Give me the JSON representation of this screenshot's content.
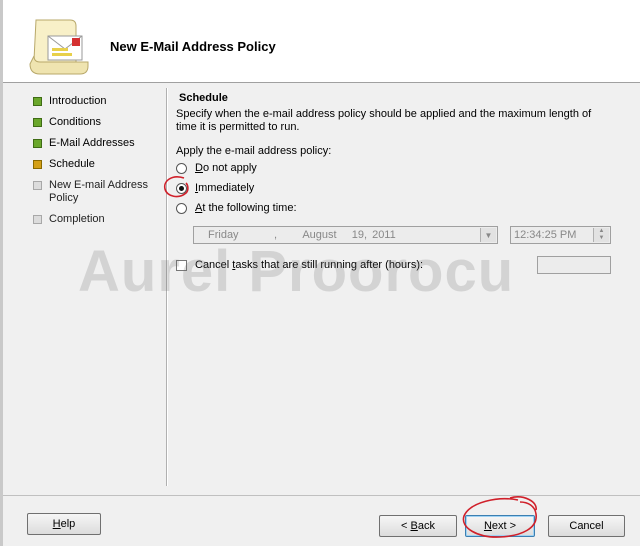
{
  "header": {
    "title": "New E-Mail Address Policy",
    "icon": "policy-scroll-icon"
  },
  "watermark": "Aurel Proorocu",
  "nav": [
    {
      "label": "Introduction",
      "state": "done"
    },
    {
      "label": "Conditions",
      "state": "done"
    },
    {
      "label": "E-Mail Addresses",
      "state": "done"
    },
    {
      "label": "Schedule",
      "state": "current"
    },
    {
      "label": "New E-mail Address Policy",
      "state": "pending"
    },
    {
      "label": "Completion",
      "state": "pending"
    }
  ],
  "schedule": {
    "title": "Schedule",
    "description": "Specify when the e-mail address policy should be applied and the maximum length of time it is permitted to run.",
    "apply_label": "Apply the e-mail address policy:",
    "options": {
      "do_not_apply": {
        "mnemonic": "D",
        "rest": "o not apply",
        "selected": false
      },
      "immediately": {
        "mnemonic": "I",
        "rest": "mmediately",
        "selected": true
      },
      "at_following_time": {
        "mnemonic": "A",
        "rest": "t the following time:",
        "selected": false
      }
    },
    "date": {
      "day": "Friday",
      "sep": ",",
      "month_day": "August   19, 2011"
    },
    "time": "12:34:25 PM",
    "cancel_tasks": {
      "pre": "Cancel ",
      "mnemonic": "t",
      "post": "asks that are still running after (hours):",
      "checked": false
    },
    "hours_value": ""
  },
  "buttons": {
    "help": {
      "mnemonic": "H",
      "rest": "elp"
    },
    "back": {
      "pre": "< ",
      "mnemonic": "B",
      "rest": "ack"
    },
    "next": {
      "mnemonic": "N",
      "rest": "ext >"
    },
    "cancel": "Cancel"
  },
  "colors": {
    "done": "#6aa72b",
    "current": "#d4a017",
    "annotation": "#d0202a"
  }
}
